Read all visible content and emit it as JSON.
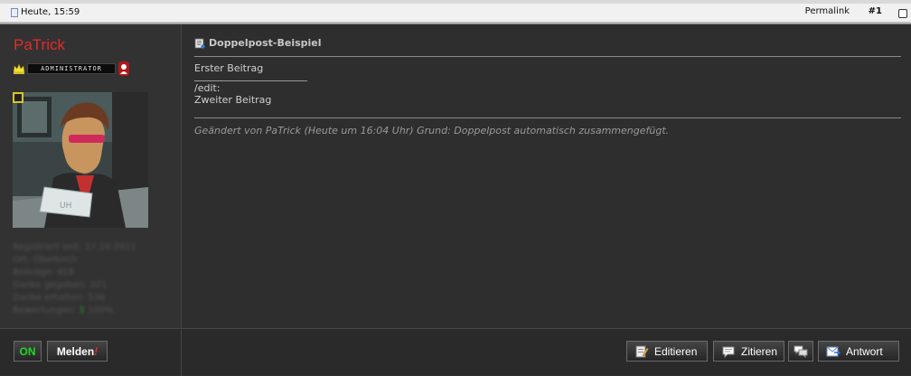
{
  "header": {
    "date": "Heute, 15:59",
    "permalink_label": "Permalink",
    "post_number": "#1"
  },
  "author": {
    "name": "PaTrick",
    "rank_label": "ADMINISTRATOR",
    "profile_lines": [
      "Registriert seit: 27.10.2011",
      "Ort: Oberkirch",
      "Beiträge: 418",
      "Danke gegeben: 221",
      "Danke erhalten: 536",
      "Bewertungen:",
      "100%"
    ],
    "rating_plus": "1"
  },
  "post": {
    "title": "Doppelpost-Beispiel",
    "line1": "Erster Beitrag",
    "edit_marker": "/edit:",
    "line2": "Zweiter Beitrag",
    "edit_note": "Geändert von PaTrick (Heute um 16:04 Uhr) Grund: Doppelpost automatisch zusammengefügt."
  },
  "footer": {
    "online_label": "ON",
    "report_label": "Melden",
    "report_bang": "!",
    "edit_label": "Editieren",
    "quote_label": "Zitieren",
    "reply_label": "Antwort"
  },
  "colors": {
    "username": "#e32a2a",
    "online": "#22d622",
    "background": "#2f2f2f"
  }
}
